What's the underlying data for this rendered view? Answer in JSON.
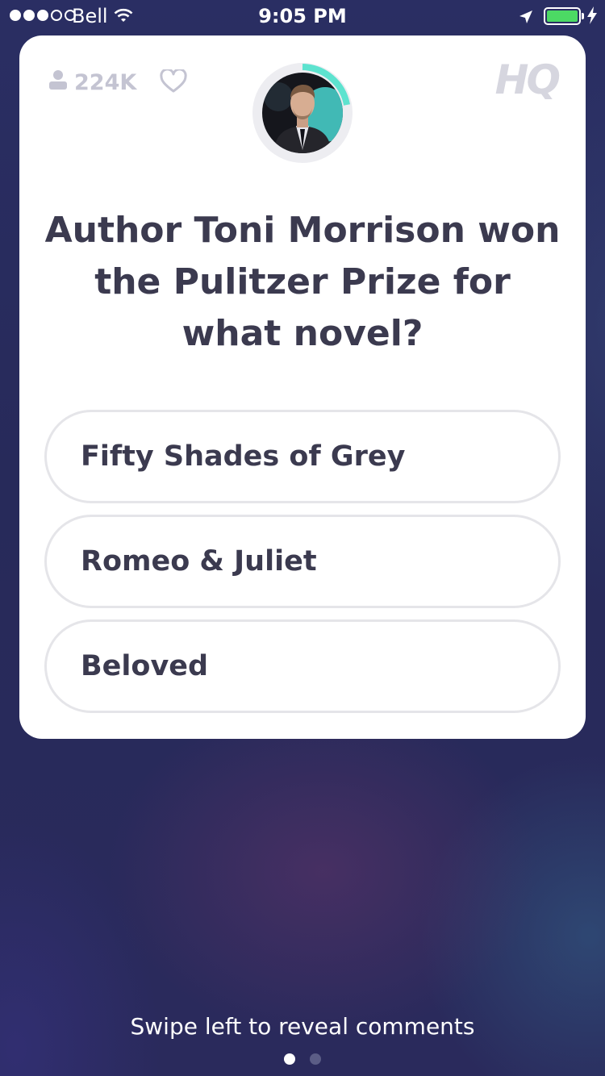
{
  "status_bar": {
    "carrier": "Bell",
    "time": "9:05 PM",
    "signal_bars": 3,
    "battery_color": "#4cd964"
  },
  "game": {
    "viewer_count": "224K",
    "logo": "HQ",
    "question": "Author Toni Morrison won the Pulitzer Prize for what novel?",
    "answers": [
      {
        "label": "Fifty Shades of Grey"
      },
      {
        "label": "Romeo & Juliet"
      },
      {
        "label": "Beloved"
      }
    ],
    "timer_ring_color": "#5de3cf"
  },
  "footer": {
    "hint": "Swipe left to reveal comments",
    "page_count": 2,
    "active_page": 1
  }
}
